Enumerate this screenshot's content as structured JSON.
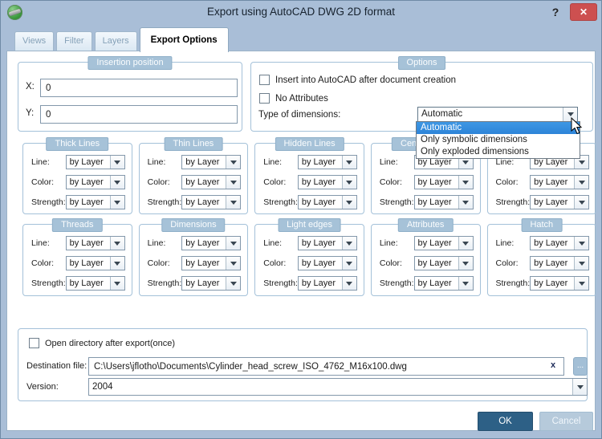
{
  "window": {
    "title": "Export using AutoCAD DWG 2D format",
    "help_label": "?",
    "close_glyph": "✕"
  },
  "tabs": [
    {
      "label": "Views",
      "active": false
    },
    {
      "label": "Filter",
      "active": false
    },
    {
      "label": "Layers",
      "active": false
    },
    {
      "label": "Export Options",
      "active": true
    }
  ],
  "insertion": {
    "title": "Insertion position",
    "fields": [
      {
        "label": "X:",
        "value": "0"
      },
      {
        "label": "Y:",
        "value": "0"
      }
    ]
  },
  "options": {
    "title": "Options",
    "checkboxes": [
      {
        "label": "Insert into AutoCAD after document creation",
        "checked": false
      },
      {
        "label": "No Attributes",
        "checked": false
      }
    ],
    "type_of_dimensions": {
      "label": "Type of dimensions:",
      "value": "Automatic",
      "items": [
        {
          "label": "Automatic",
          "selected": true
        },
        {
          "label": "Only symbolic dimensions",
          "selected": false
        },
        {
          "label": "Only exploded dimensions",
          "selected": false
        }
      ]
    }
  },
  "line_groups": {
    "field_labels": [
      "Line:",
      "Color:",
      "Strength:"
    ],
    "field_value": "by Layer",
    "rows": [
      [
        {
          "title": "Thick Lines"
        },
        {
          "title": "Thin Lines"
        },
        {
          "title": "Hidden Lines"
        },
        {
          "title": "Center Lines"
        },
        {
          "title": ""
        }
      ],
      [
        {
          "title": "Threads"
        },
        {
          "title": "Dimensions"
        },
        {
          "title": "Light edges"
        },
        {
          "title": "Attributes"
        },
        {
          "title": "Hatch"
        }
      ]
    ]
  },
  "export": {
    "open_dir": {
      "label": "Open directory after export(once)",
      "checked": false
    },
    "destination": {
      "label": "Destination file:",
      "value": "C:\\Users\\jflotho\\Documents\\Cylinder_head_screw_ISO_4762_M16x100.dwg",
      "clear_glyph": "x",
      "browse_label": "..."
    },
    "version": {
      "label": "Version:",
      "value": "2004"
    }
  },
  "buttons": {
    "ok": "OK",
    "cancel": "Cancel"
  },
  "colors": {
    "titlebar": "#a9bed7",
    "accent": "#2d6086",
    "badge": "#a6c2d8",
    "highlight": "#2d84d8",
    "close": "#cd5050"
  }
}
